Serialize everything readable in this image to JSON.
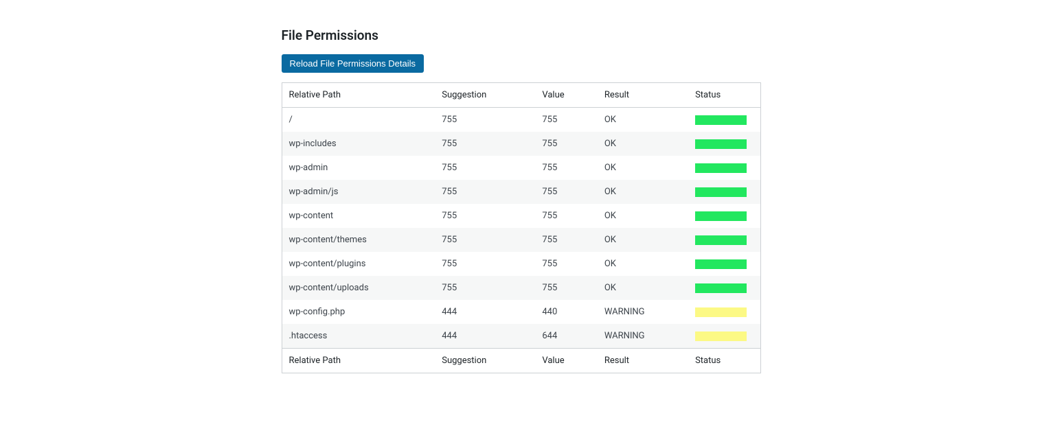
{
  "title": "File Permissions",
  "buttons": {
    "reload_label": "Reload File Permissions Details"
  },
  "table": {
    "headers": {
      "path": "Relative Path",
      "suggestion": "Suggestion",
      "value": "Value",
      "result": "Result",
      "status": "Status"
    },
    "rows": [
      {
        "path": "/",
        "suggestion": "755",
        "value": "755",
        "result": "OK",
        "status": "ok"
      },
      {
        "path": "wp-includes",
        "suggestion": "755",
        "value": "755",
        "result": "OK",
        "status": "ok"
      },
      {
        "path": "wp-admin",
        "suggestion": "755",
        "value": "755",
        "result": "OK",
        "status": "ok"
      },
      {
        "path": "wp-admin/js",
        "suggestion": "755",
        "value": "755",
        "result": "OK",
        "status": "ok"
      },
      {
        "path": "wp-content",
        "suggestion": "755",
        "value": "755",
        "result": "OK",
        "status": "ok"
      },
      {
        "path": "wp-content/themes",
        "suggestion": "755",
        "value": "755",
        "result": "OK",
        "status": "ok"
      },
      {
        "path": "wp-content/plugins",
        "suggestion": "755",
        "value": "755",
        "result": "OK",
        "status": "ok"
      },
      {
        "path": "wp-content/uploads",
        "suggestion": "755",
        "value": "755",
        "result": "OK",
        "status": "ok"
      },
      {
        "path": "wp-config.php",
        "suggestion": "444",
        "value": "440",
        "result": "WARNING",
        "status": "warn"
      },
      {
        "path": ".htaccess",
        "suggestion": "444",
        "value": "644",
        "result": "WARNING",
        "status": "warn"
      }
    ],
    "footers": {
      "path": "Relative Path",
      "suggestion": "Suggestion",
      "value": "Value",
      "result": "Result",
      "status": "Status"
    }
  },
  "status_colors": {
    "ok": "#22e75f",
    "warn": "#fcf985"
  }
}
